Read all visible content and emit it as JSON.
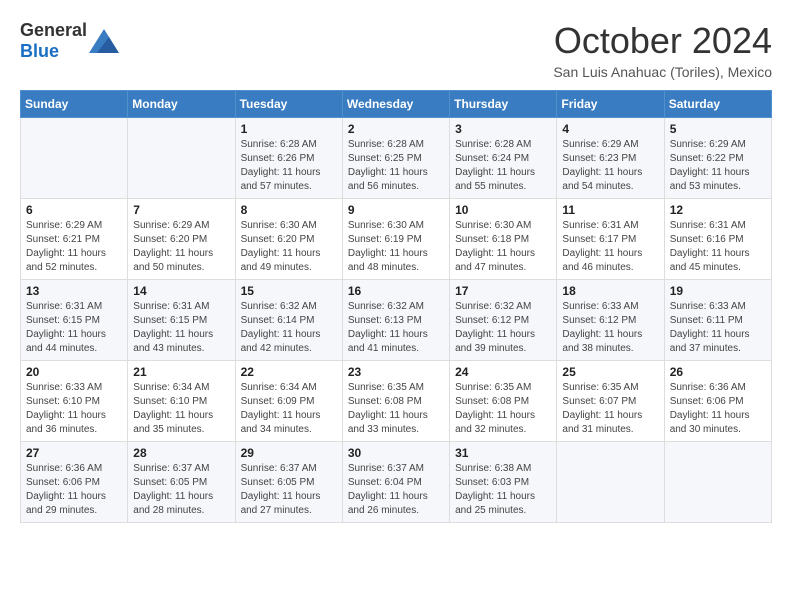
{
  "header": {
    "logo_general": "General",
    "logo_blue": "Blue",
    "month_title": "October 2024",
    "location": "San Luis Anahuac (Toriles), Mexico"
  },
  "calendar": {
    "days_of_week": [
      "Sunday",
      "Monday",
      "Tuesday",
      "Wednesday",
      "Thursday",
      "Friday",
      "Saturday"
    ],
    "weeks": [
      [
        {
          "day": "",
          "info": ""
        },
        {
          "day": "",
          "info": ""
        },
        {
          "day": "1",
          "info": "Sunrise: 6:28 AM\nSunset: 6:26 PM\nDaylight: 11 hours and 57 minutes."
        },
        {
          "day": "2",
          "info": "Sunrise: 6:28 AM\nSunset: 6:25 PM\nDaylight: 11 hours and 56 minutes."
        },
        {
          "day": "3",
          "info": "Sunrise: 6:28 AM\nSunset: 6:24 PM\nDaylight: 11 hours and 55 minutes."
        },
        {
          "day": "4",
          "info": "Sunrise: 6:29 AM\nSunset: 6:23 PM\nDaylight: 11 hours and 54 minutes."
        },
        {
          "day": "5",
          "info": "Sunrise: 6:29 AM\nSunset: 6:22 PM\nDaylight: 11 hours and 53 minutes."
        }
      ],
      [
        {
          "day": "6",
          "info": "Sunrise: 6:29 AM\nSunset: 6:21 PM\nDaylight: 11 hours and 52 minutes."
        },
        {
          "day": "7",
          "info": "Sunrise: 6:29 AM\nSunset: 6:20 PM\nDaylight: 11 hours and 50 minutes."
        },
        {
          "day": "8",
          "info": "Sunrise: 6:30 AM\nSunset: 6:20 PM\nDaylight: 11 hours and 49 minutes."
        },
        {
          "day": "9",
          "info": "Sunrise: 6:30 AM\nSunset: 6:19 PM\nDaylight: 11 hours and 48 minutes."
        },
        {
          "day": "10",
          "info": "Sunrise: 6:30 AM\nSunset: 6:18 PM\nDaylight: 11 hours and 47 minutes."
        },
        {
          "day": "11",
          "info": "Sunrise: 6:31 AM\nSunset: 6:17 PM\nDaylight: 11 hours and 46 minutes."
        },
        {
          "day": "12",
          "info": "Sunrise: 6:31 AM\nSunset: 6:16 PM\nDaylight: 11 hours and 45 minutes."
        }
      ],
      [
        {
          "day": "13",
          "info": "Sunrise: 6:31 AM\nSunset: 6:15 PM\nDaylight: 11 hours and 44 minutes."
        },
        {
          "day": "14",
          "info": "Sunrise: 6:31 AM\nSunset: 6:15 PM\nDaylight: 11 hours and 43 minutes."
        },
        {
          "day": "15",
          "info": "Sunrise: 6:32 AM\nSunset: 6:14 PM\nDaylight: 11 hours and 42 minutes."
        },
        {
          "day": "16",
          "info": "Sunrise: 6:32 AM\nSunset: 6:13 PM\nDaylight: 11 hours and 41 minutes."
        },
        {
          "day": "17",
          "info": "Sunrise: 6:32 AM\nSunset: 6:12 PM\nDaylight: 11 hours and 39 minutes."
        },
        {
          "day": "18",
          "info": "Sunrise: 6:33 AM\nSunset: 6:12 PM\nDaylight: 11 hours and 38 minutes."
        },
        {
          "day": "19",
          "info": "Sunrise: 6:33 AM\nSunset: 6:11 PM\nDaylight: 11 hours and 37 minutes."
        }
      ],
      [
        {
          "day": "20",
          "info": "Sunrise: 6:33 AM\nSunset: 6:10 PM\nDaylight: 11 hours and 36 minutes."
        },
        {
          "day": "21",
          "info": "Sunrise: 6:34 AM\nSunset: 6:10 PM\nDaylight: 11 hours and 35 minutes."
        },
        {
          "day": "22",
          "info": "Sunrise: 6:34 AM\nSunset: 6:09 PM\nDaylight: 11 hours and 34 minutes."
        },
        {
          "day": "23",
          "info": "Sunrise: 6:35 AM\nSunset: 6:08 PM\nDaylight: 11 hours and 33 minutes."
        },
        {
          "day": "24",
          "info": "Sunrise: 6:35 AM\nSunset: 6:08 PM\nDaylight: 11 hours and 32 minutes."
        },
        {
          "day": "25",
          "info": "Sunrise: 6:35 AM\nSunset: 6:07 PM\nDaylight: 11 hours and 31 minutes."
        },
        {
          "day": "26",
          "info": "Sunrise: 6:36 AM\nSunset: 6:06 PM\nDaylight: 11 hours and 30 minutes."
        }
      ],
      [
        {
          "day": "27",
          "info": "Sunrise: 6:36 AM\nSunset: 6:06 PM\nDaylight: 11 hours and 29 minutes."
        },
        {
          "day": "28",
          "info": "Sunrise: 6:37 AM\nSunset: 6:05 PM\nDaylight: 11 hours and 28 minutes."
        },
        {
          "day": "29",
          "info": "Sunrise: 6:37 AM\nSunset: 6:05 PM\nDaylight: 11 hours and 27 minutes."
        },
        {
          "day": "30",
          "info": "Sunrise: 6:37 AM\nSunset: 6:04 PM\nDaylight: 11 hours and 26 minutes."
        },
        {
          "day": "31",
          "info": "Sunrise: 6:38 AM\nSunset: 6:03 PM\nDaylight: 11 hours and 25 minutes."
        },
        {
          "day": "",
          "info": ""
        },
        {
          "day": "",
          "info": ""
        }
      ]
    ]
  }
}
